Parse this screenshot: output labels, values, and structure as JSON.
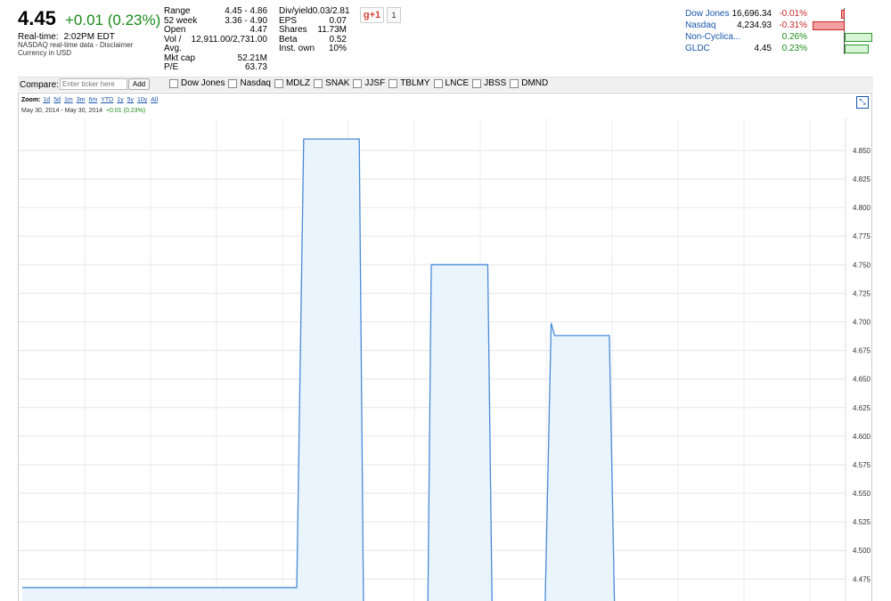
{
  "quote": {
    "price": "4.45",
    "change": "+0.01 (0.23%)",
    "realtime_label": "Real-time:",
    "realtime_time": "2:02PM EDT",
    "nasdaq_note": "NASDAQ real-time data - Disclaimer",
    "currency": "Currency in USD"
  },
  "stats_left": [
    {
      "label": "Range",
      "value": "4.45 - 4.86"
    },
    {
      "label": "52 week",
      "value": "3.36 - 4.90"
    },
    {
      "label": "Open",
      "value": "4.47"
    },
    {
      "label": "Vol / Avg.",
      "value": "12,911.00/2,731.00"
    },
    {
      "label": "Mkt cap",
      "value": "52.21M"
    },
    {
      "label": "P/E",
      "value": "63.73"
    }
  ],
  "stats_right": [
    {
      "label": "Div/yield",
      "value": "0.03/2.81"
    },
    {
      "label": "EPS",
      "value": "0.07"
    },
    {
      "label": "Shares",
      "value": "11.73M"
    },
    {
      "label": "Beta",
      "value": "0.52"
    },
    {
      "label": "Inst. own",
      "value": "10%"
    }
  ],
  "social": {
    "gplus_label": "g+1",
    "gplus_count": "1"
  },
  "indices": [
    {
      "name": "Dow Jones",
      "value": "16,696.34",
      "change": "-0.01%",
      "direction": "neg",
      "bar_pct": 0.01
    },
    {
      "name": "Nasdaq",
      "value": "4,234.93",
      "change": "-0.31%",
      "direction": "neg",
      "bar_pct": 0.31
    },
    {
      "name": "Non-Cyclica...",
      "value": "",
      "change": "0.26%",
      "direction": "pos",
      "bar_pct": 0.26
    },
    {
      "name": "GLDC",
      "value": "4.45",
      "change": "0.23%",
      "direction": "pos",
      "bar_pct": 0.23
    }
  ],
  "compare": {
    "label": "Compare:",
    "placeholder": "Enter ticker here",
    "add_label": "Add",
    "tickers": [
      "Dow Jones",
      "Nasdaq",
      "MDLZ",
      "SNAK",
      "JJSF",
      "TBLMY",
      "LNCE",
      "JBSS",
      "DMND"
    ]
  },
  "zoom": {
    "label": "Zoom:",
    "options": [
      "1d",
      "5d",
      "1m",
      "3m",
      "6m",
      "YTD",
      "1y",
      "5y",
      "10y",
      "All"
    ],
    "date_range": "May 30, 2014  -  May 30, 2014",
    "range_change": "+0.01 (0.23%)"
  },
  "colors": {
    "line": "#4a8ad6",
    "fill": "#eaf4fd",
    "positive": "#1a8a1a",
    "negative": "#c62828",
    "link": "#1a55aa"
  },
  "chart_data": {
    "type": "area",
    "y_ticks": [
      "4.850",
      "4.825",
      "4.800",
      "4.775",
      "4.750",
      "4.725",
      "4.700",
      "4.675",
      "4.650",
      "4.625",
      "4.600",
      "4.575",
      "4.550",
      "4.525",
      "4.500",
      "4.475"
    ],
    "ylim": [
      4.455,
      4.878
    ],
    "grid": true,
    "segments": [
      {
        "points": [
          [
            0,
            4.4675
          ],
          [
            0.3334,
            4.4675
          ],
          [
            0.3418,
            4.86
          ],
          [
            0.4093,
            4.86
          ],
          [
            0.4145,
            4.45
          ]
        ]
      },
      {
        "points": [
          [
            0.4926,
            4.45
          ],
          [
            0.4968,
            4.75
          ],
          [
            0.5654,
            4.75
          ],
          [
            0.5707,
            4.45
          ]
        ]
      },
      {
        "points": [
          [
            0.635,
            4.45
          ],
          [
            0.6424,
            4.699
          ],
          [
            0.6466,
            4.688
          ],
          [
            0.7131,
            4.688
          ],
          [
            0.7194,
            4.45
          ]
        ]
      }
    ]
  }
}
